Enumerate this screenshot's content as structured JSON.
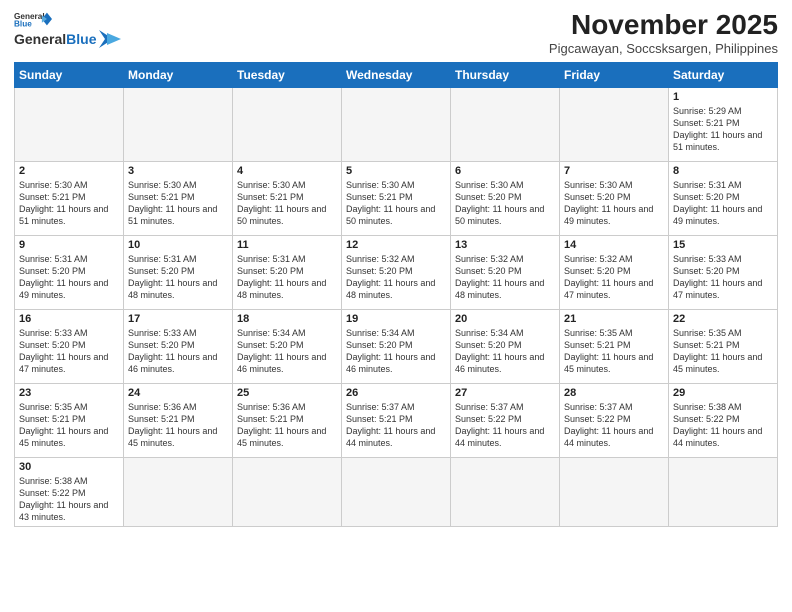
{
  "header": {
    "logo_text_general": "General",
    "logo_text_blue": "Blue",
    "title": "November 2025",
    "subtitle": "Pigcawayan, Soccsksargen, Philippines"
  },
  "weekdays": [
    "Sunday",
    "Monday",
    "Tuesday",
    "Wednesday",
    "Thursday",
    "Friday",
    "Saturday"
  ],
  "days": {
    "1": {
      "sunrise": "5:29 AM",
      "sunset": "5:21 PM",
      "daylight": "11 hours and 51 minutes."
    },
    "2": {
      "sunrise": "5:30 AM",
      "sunset": "5:21 PM",
      "daylight": "11 hours and 51 minutes."
    },
    "3": {
      "sunrise": "5:30 AM",
      "sunset": "5:21 PM",
      "daylight": "11 hours and 51 minutes."
    },
    "4": {
      "sunrise": "5:30 AM",
      "sunset": "5:21 PM",
      "daylight": "11 hours and 50 minutes."
    },
    "5": {
      "sunrise": "5:30 AM",
      "sunset": "5:21 PM",
      "daylight": "11 hours and 50 minutes."
    },
    "6": {
      "sunrise": "5:30 AM",
      "sunset": "5:20 PM",
      "daylight": "11 hours and 50 minutes."
    },
    "7": {
      "sunrise": "5:30 AM",
      "sunset": "5:20 PM",
      "daylight": "11 hours and 49 minutes."
    },
    "8": {
      "sunrise": "5:31 AM",
      "sunset": "5:20 PM",
      "daylight": "11 hours and 49 minutes."
    },
    "9": {
      "sunrise": "5:31 AM",
      "sunset": "5:20 PM",
      "daylight": "11 hours and 49 minutes."
    },
    "10": {
      "sunrise": "5:31 AM",
      "sunset": "5:20 PM",
      "daylight": "11 hours and 48 minutes."
    },
    "11": {
      "sunrise": "5:31 AM",
      "sunset": "5:20 PM",
      "daylight": "11 hours and 48 minutes."
    },
    "12": {
      "sunrise": "5:32 AM",
      "sunset": "5:20 PM",
      "daylight": "11 hours and 48 minutes."
    },
    "13": {
      "sunrise": "5:32 AM",
      "sunset": "5:20 PM",
      "daylight": "11 hours and 48 minutes."
    },
    "14": {
      "sunrise": "5:32 AM",
      "sunset": "5:20 PM",
      "daylight": "11 hours and 47 minutes."
    },
    "15": {
      "sunrise": "5:33 AM",
      "sunset": "5:20 PM",
      "daylight": "11 hours and 47 minutes."
    },
    "16": {
      "sunrise": "5:33 AM",
      "sunset": "5:20 PM",
      "daylight": "11 hours and 47 minutes."
    },
    "17": {
      "sunrise": "5:33 AM",
      "sunset": "5:20 PM",
      "daylight": "11 hours and 46 minutes."
    },
    "18": {
      "sunrise": "5:34 AM",
      "sunset": "5:20 PM",
      "daylight": "11 hours and 46 minutes."
    },
    "19": {
      "sunrise": "5:34 AM",
      "sunset": "5:20 PM",
      "daylight": "11 hours and 46 minutes."
    },
    "20": {
      "sunrise": "5:34 AM",
      "sunset": "5:20 PM",
      "daylight": "11 hours and 46 minutes."
    },
    "21": {
      "sunrise": "5:35 AM",
      "sunset": "5:21 PM",
      "daylight": "11 hours and 45 minutes."
    },
    "22": {
      "sunrise": "5:35 AM",
      "sunset": "5:21 PM",
      "daylight": "11 hours and 45 minutes."
    },
    "23": {
      "sunrise": "5:35 AM",
      "sunset": "5:21 PM",
      "daylight": "11 hours and 45 minutes."
    },
    "24": {
      "sunrise": "5:36 AM",
      "sunset": "5:21 PM",
      "daylight": "11 hours and 45 minutes."
    },
    "25": {
      "sunrise": "5:36 AM",
      "sunset": "5:21 PM",
      "daylight": "11 hours and 45 minutes."
    },
    "26": {
      "sunrise": "5:37 AM",
      "sunset": "5:21 PM",
      "daylight": "11 hours and 44 minutes."
    },
    "27": {
      "sunrise": "5:37 AM",
      "sunset": "5:22 PM",
      "daylight": "11 hours and 44 minutes."
    },
    "28": {
      "sunrise": "5:37 AM",
      "sunset": "5:22 PM",
      "daylight": "11 hours and 44 minutes."
    },
    "29": {
      "sunrise": "5:38 AM",
      "sunset": "5:22 PM",
      "daylight": "11 hours and 44 minutes."
    },
    "30": {
      "sunrise": "5:38 AM",
      "sunset": "5:22 PM",
      "daylight": "11 hours and 43 minutes."
    }
  },
  "labels": {
    "sunrise": "Sunrise:",
    "sunset": "Sunset:",
    "daylight": "Daylight:"
  }
}
